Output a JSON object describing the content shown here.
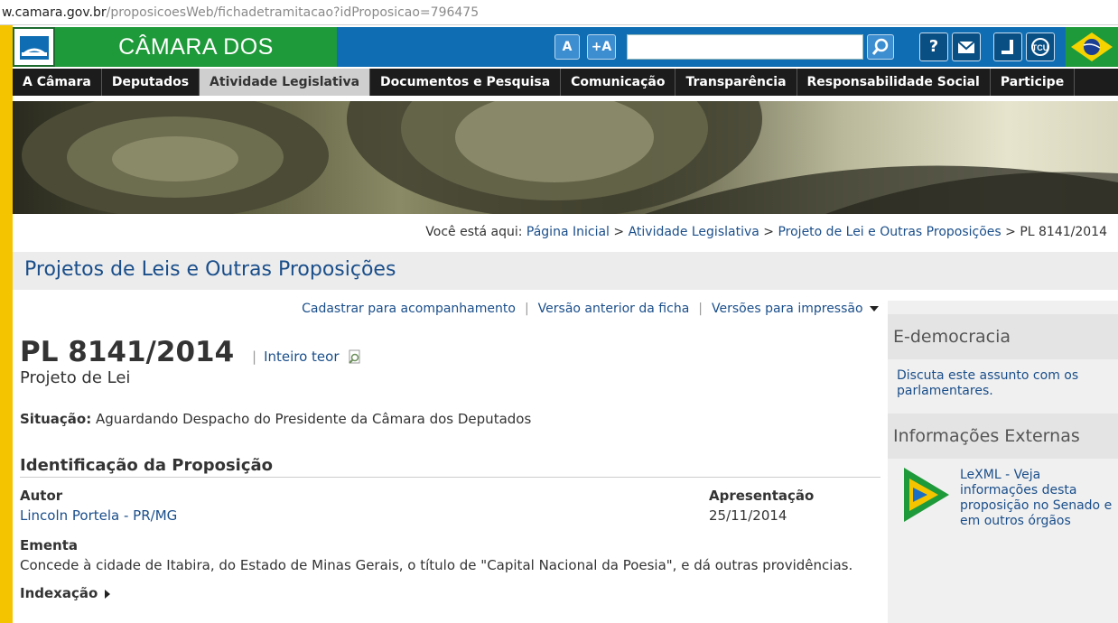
{
  "browser": {
    "url_host": "w.camara.gov.br",
    "url_path": "/proposicoesWeb/fichadetramitacao?idProposicao=796475"
  },
  "header": {
    "brand": "CÂMARA DOS DEPUTADOS",
    "font_decrease_label": "A",
    "font_increase_label": "+A",
    "search_placeholder": "",
    "icons": [
      "question-icon",
      "mail-icon",
      "accessibility-icon",
      "tcu-icon",
      "brazil-flag-icon"
    ],
    "help_label": "?"
  },
  "nav": {
    "items": [
      {
        "label": "A Câmara"
      },
      {
        "label": "Deputados"
      },
      {
        "label": "Atividade Legislativa",
        "active": true
      },
      {
        "label": "Documentos e Pesquisa"
      },
      {
        "label": "Comunicação"
      },
      {
        "label": "Transparência"
      },
      {
        "label": "Responsabilidade Social"
      },
      {
        "label": "Participe"
      }
    ]
  },
  "breadcrumb": {
    "prefix": "Você está aqui:",
    "items": [
      "Página Inicial",
      "Atividade Legislativa",
      "Projeto de Lei e Outras Proposições",
      "PL 8141/2014"
    ]
  },
  "page": {
    "title": "Projetos de Leis e Outras Proposições"
  },
  "actions": {
    "register": "Cadastrar para acompanhamento",
    "previous": "Versão anterior da ficha",
    "print": "Versões para impressão"
  },
  "proposition": {
    "number": "PL 8141/2014",
    "full_text_link": "Inteiro teor",
    "type": "Projeto de Lei",
    "status_label": "Situação:",
    "status_value": "Aguardando Despacho do Presidente da Câmara dos Deputados",
    "ident_heading": "Identificação da Proposição",
    "author_label": "Autor",
    "author_value": "Lincoln Portela - PR/MG",
    "presentation_label": "Apresentação",
    "presentation_value": "25/11/2014",
    "ementa_label": "Ementa",
    "ementa_value": "Concede à cidade de Itabira, do Estado de Minas Gerais, o título de \"Capital Nacional da Poesia\", e dá outras providências.",
    "indexacao_label": "Indexação"
  },
  "sidebar": {
    "edemocracia_title": "E-democracia",
    "edemocracia_link": "Discuta este assunto com os parlamentares.",
    "external_title": "Informações Externas",
    "lexml_text": "LeXML - Veja informações desta proposição no Senado e em outros órgãos"
  },
  "colors": {
    "brand_green": "#1f9a3a",
    "header_blue": "#0f6eb3",
    "nav_black": "#1c1c1c",
    "link_blue": "#1a4e8a",
    "accent_yellow": "#f5c400"
  }
}
